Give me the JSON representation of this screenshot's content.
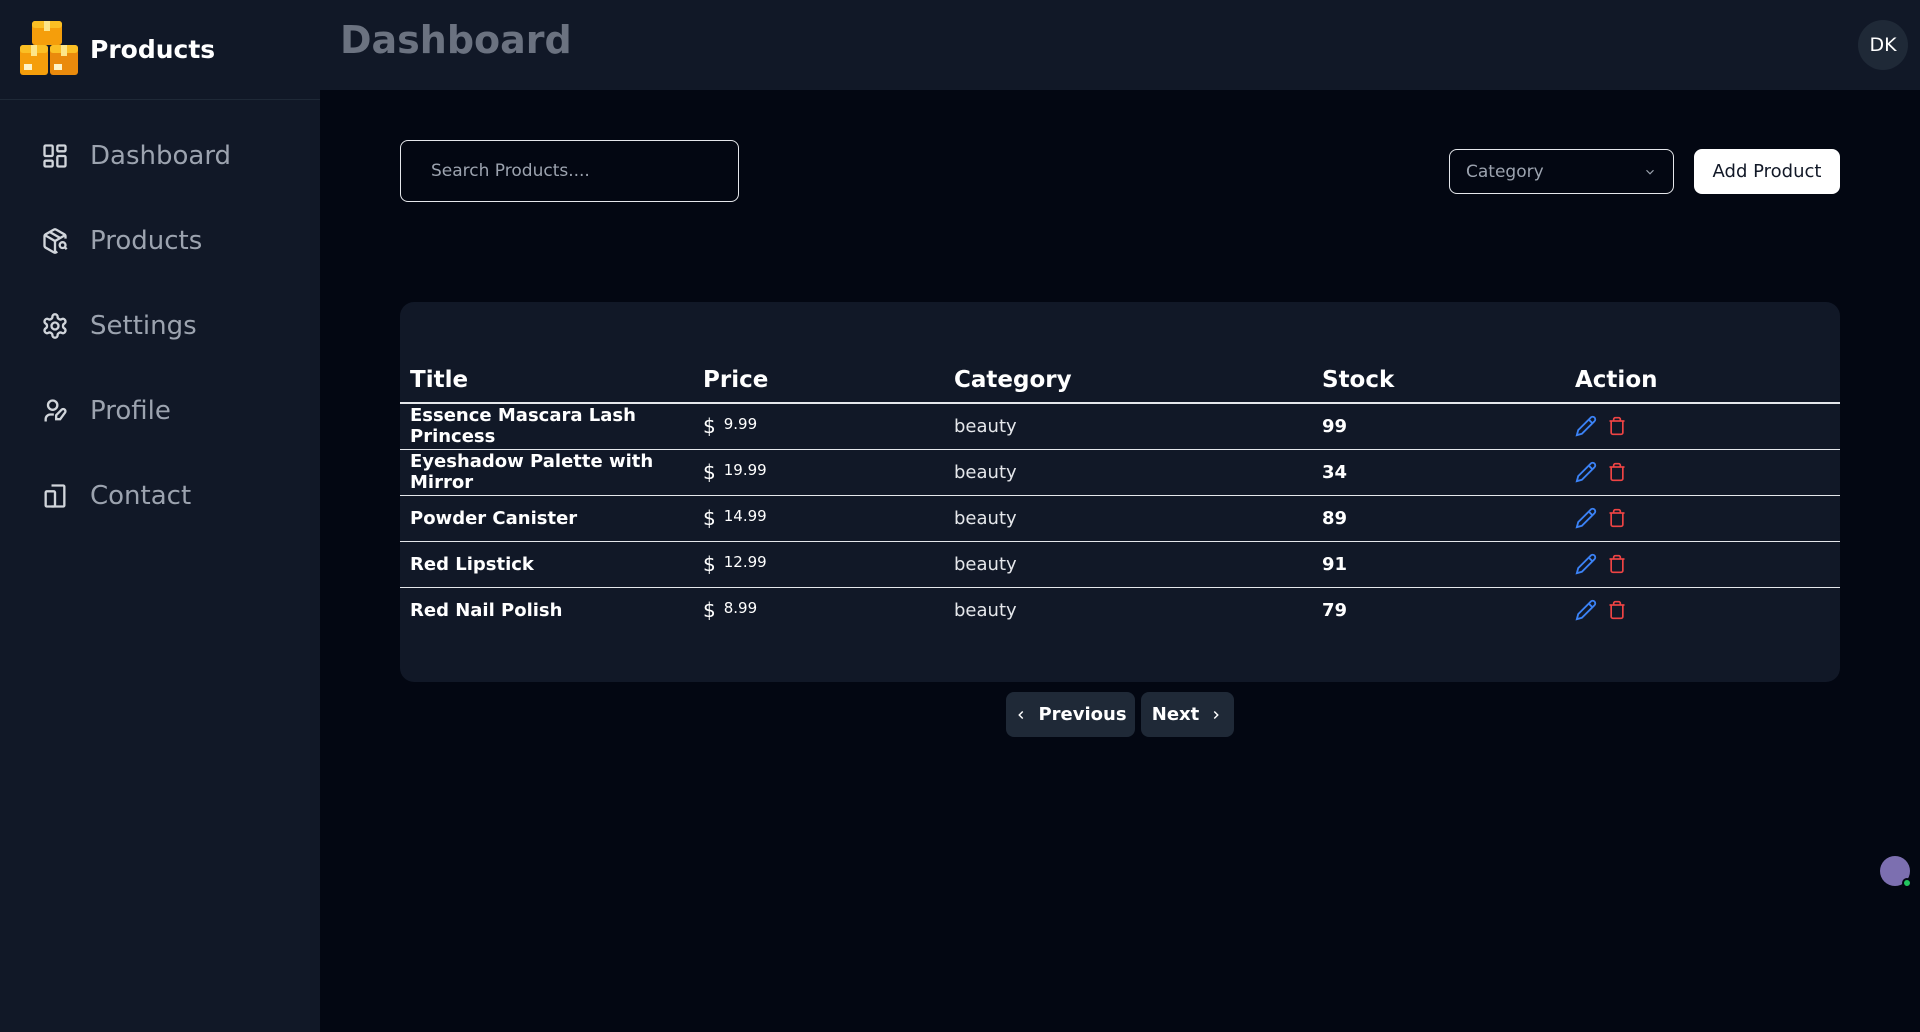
{
  "brand": {
    "name": "Products"
  },
  "sidebar": {
    "items": [
      {
        "label": "Dashboard",
        "icon": "dashboard-grid-icon"
      },
      {
        "label": "Products",
        "icon": "package-search-icon"
      },
      {
        "label": "Settings",
        "icon": "gear-icon"
      },
      {
        "label": "Profile",
        "icon": "user-edit-icon"
      },
      {
        "label": "Contact",
        "icon": "phone-icon"
      }
    ]
  },
  "header": {
    "title": "Dashboard",
    "avatar_initials": "DK"
  },
  "toolbar": {
    "search_placeholder": "Search Products....",
    "category_placeholder": "Category",
    "add_label": "Add Product"
  },
  "table": {
    "columns": [
      "Title",
      "Price",
      "Category",
      "Stock",
      "Action"
    ],
    "currency": "$",
    "rows": [
      {
        "title": "Essence Mascara Lash Princess",
        "price": "9.99",
        "category": "beauty",
        "stock": "99"
      },
      {
        "title": "Eyeshadow Palette with Mirror",
        "price": "19.99",
        "category": "beauty",
        "stock": "34"
      },
      {
        "title": "Powder Canister",
        "price": "14.99",
        "category": "beauty",
        "stock": "89"
      },
      {
        "title": "Red Lipstick",
        "price": "12.99",
        "category": "beauty",
        "stock": "91"
      },
      {
        "title": "Red Nail Polish",
        "price": "8.99",
        "category": "beauty",
        "stock": "79"
      }
    ]
  },
  "pagination": {
    "prev_label": "Previous",
    "next_label": "Next"
  },
  "colors": {
    "edit": "#3b82f6",
    "delete": "#ef4444",
    "logo": "#f59e0b"
  }
}
